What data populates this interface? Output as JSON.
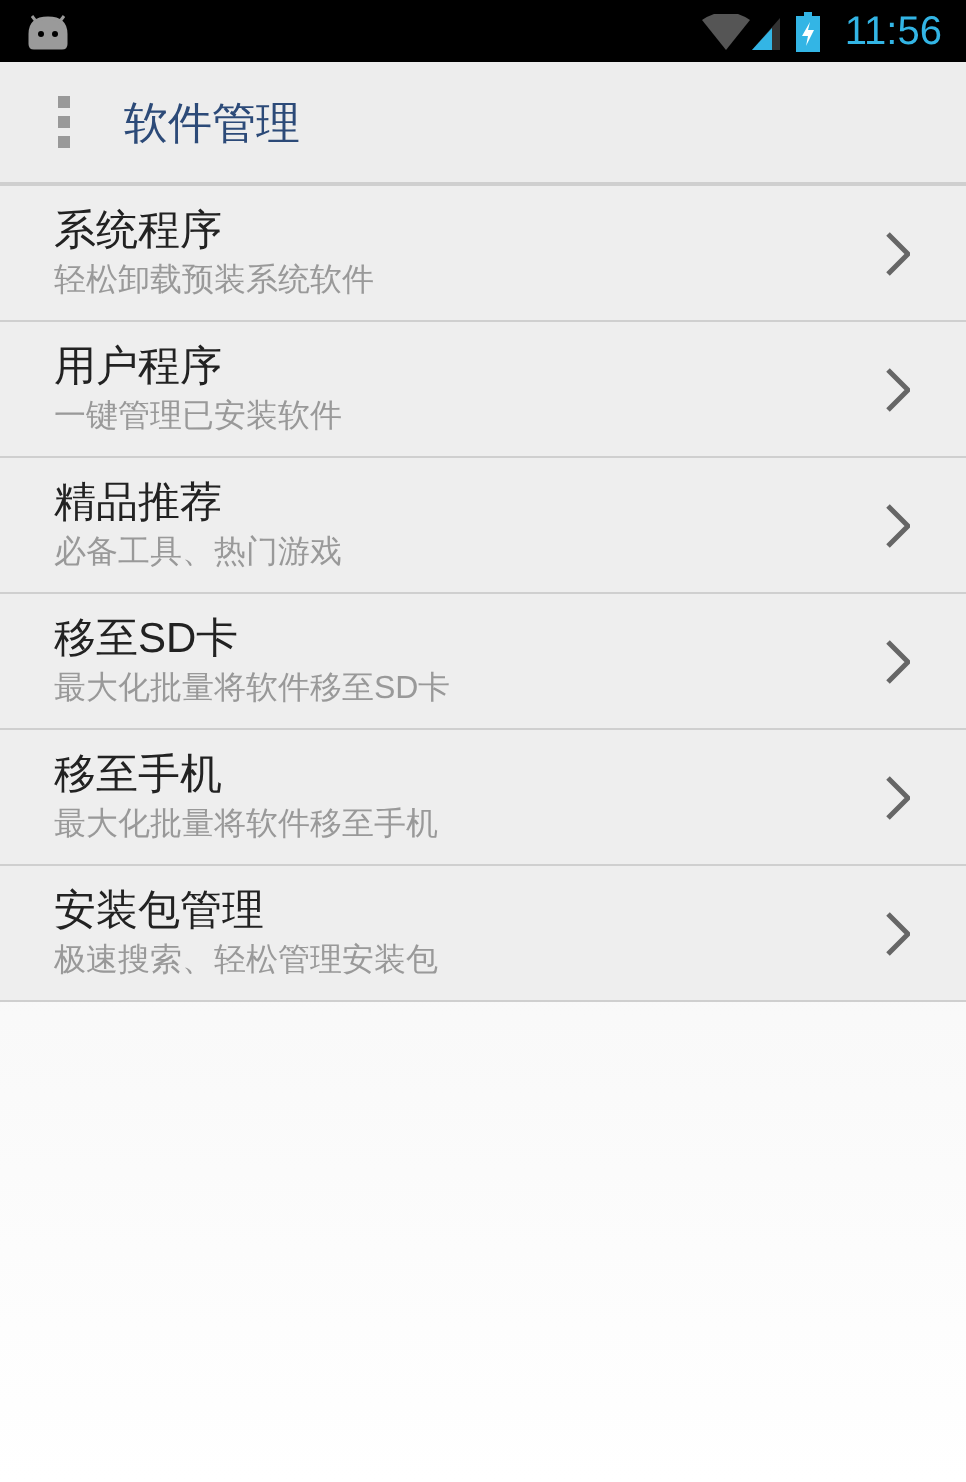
{
  "status_bar": {
    "time": "11:56"
  },
  "action_bar": {
    "title": "软件管理"
  },
  "items": [
    {
      "title": "系统程序",
      "subtitle": "轻松卸载预装系统软件"
    },
    {
      "title": "用户程序",
      "subtitle": "一键管理已安装软件"
    },
    {
      "title": "精品推荐",
      "subtitle": "必备工具、热门游戏"
    },
    {
      "title": "移至SD卡",
      "subtitle": "最大化批量将软件移至SD卡"
    },
    {
      "title": "移至手机",
      "subtitle": "最大化批量将软件移至手机"
    },
    {
      "title": "安装包管理",
      "subtitle": "极速搜索、轻松管理安装包"
    }
  ]
}
